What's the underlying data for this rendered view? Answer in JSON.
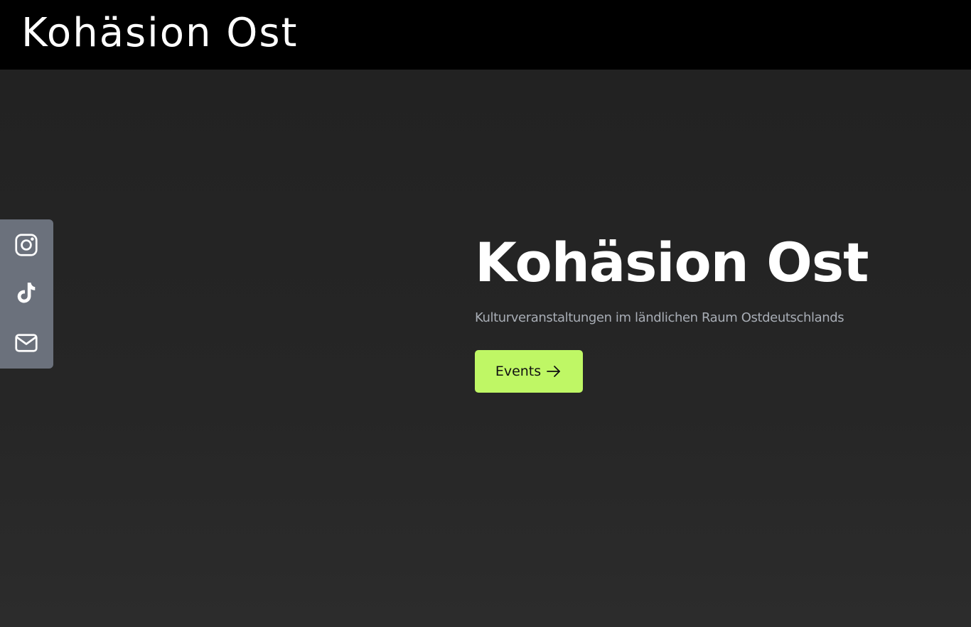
{
  "header": {
    "brand": "Kohäsion Ost"
  },
  "social": {
    "items": [
      {
        "icon": "instagram-icon"
      },
      {
        "icon": "tiktok-icon"
      },
      {
        "icon": "mail-icon"
      }
    ]
  },
  "hero": {
    "title": "Kohäsion Ost",
    "subtitle": "Kulturveranstaltungen im ländlichen Raum Ostdeutschlands",
    "cta_label": "Events",
    "cta_icon": "arrow-right-icon"
  },
  "colors": {
    "header_bg": "#000000",
    "page_bg": "#232323",
    "social_bar_bg": "#6b717c",
    "accent": "#bff765",
    "subtitle_text": "#a8adb5"
  }
}
